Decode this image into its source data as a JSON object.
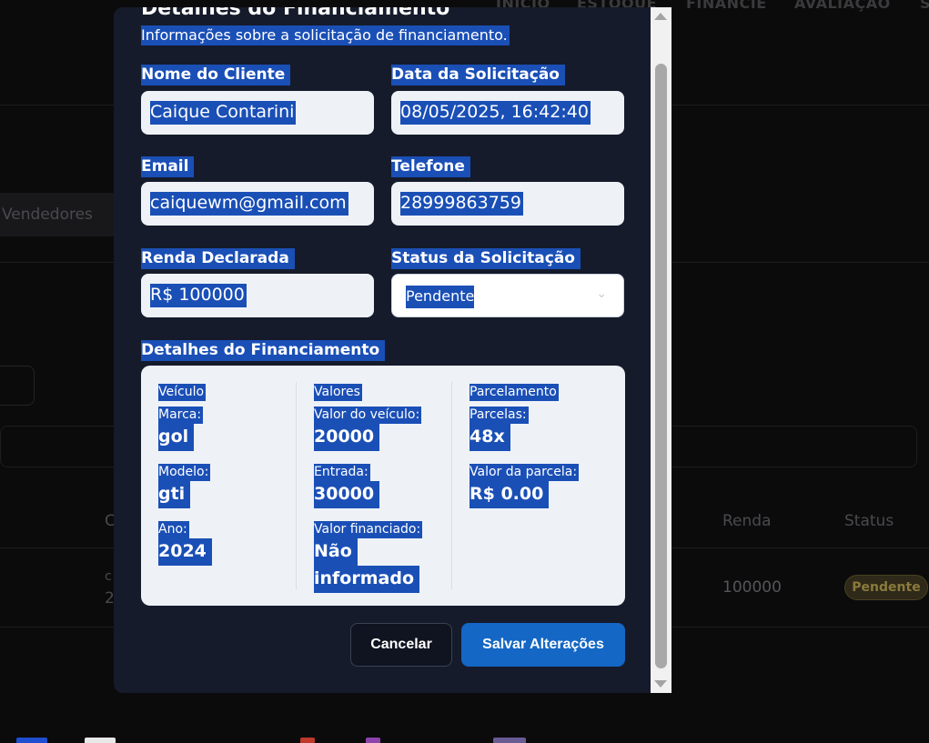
{
  "background": {
    "nav": [
      "INÍCIO",
      "ESTOQUE",
      "FINANCIE",
      "AVALIAÇÃO",
      "S"
    ],
    "tab_label": "Vendedores",
    "table_headers": {
      "c": "C",
      "renda": "Renda",
      "status": "Status"
    },
    "row": {
      "c_frag": "c",
      "num_frag": "2",
      "renda": "100000",
      "status": "Pendente"
    }
  },
  "modal": {
    "title": "Detalhes do Financiamento",
    "subtitle": "Informações sobre a solicitação de financiamento.",
    "fields": {
      "nome_label": "Nome do Cliente",
      "nome_value": "Caique Contarini",
      "data_label": "Data da Solicitação",
      "data_value": "08/05/2025, 16:42:40",
      "email_label": "Email",
      "email_value": "caiquewm@gmail.com",
      "telefone_label": "Telefone",
      "telefone_value": "28999863759",
      "renda_label": "Renda Declarada",
      "renda_value": "R$ 100000",
      "status_label": "Status da Solicitação",
      "status_value": "Pendente"
    },
    "financing": {
      "section_label": "Detalhes do Financiamento",
      "veiculo": {
        "heading": "Veículo",
        "marca_label": "Marca:",
        "marca_value": "gol",
        "modelo_label": "Modelo:",
        "modelo_value": "gti",
        "ano_label": "Ano:",
        "ano_value": "2024"
      },
      "valores": {
        "heading": "Valores",
        "valor_veiculo_label": "Valor do veículo:",
        "valor_veiculo_value": "20000",
        "entrada_label": "Entrada:",
        "entrada_value": "30000",
        "valor_financiado_label": "Valor financiado:",
        "valor_financiado_value_1": "Não",
        "valor_financiado_value_2": "informado"
      },
      "parcelamento": {
        "heading": "Parcelamento",
        "parcelas_label": "Parcelas:",
        "parcelas_value": "48x",
        "valor_parcela_label": "Valor da parcela:",
        "valor_parcela_value": "R$ 0.00"
      }
    },
    "buttons": {
      "cancel": "Cancelar",
      "save": "Salvar Alterações"
    }
  },
  "colors": {
    "selection": "#1a4fb6",
    "primary_button": "#1467c4",
    "modal_bg": "#151b2b",
    "badge_pending": "#8a7a3c"
  }
}
